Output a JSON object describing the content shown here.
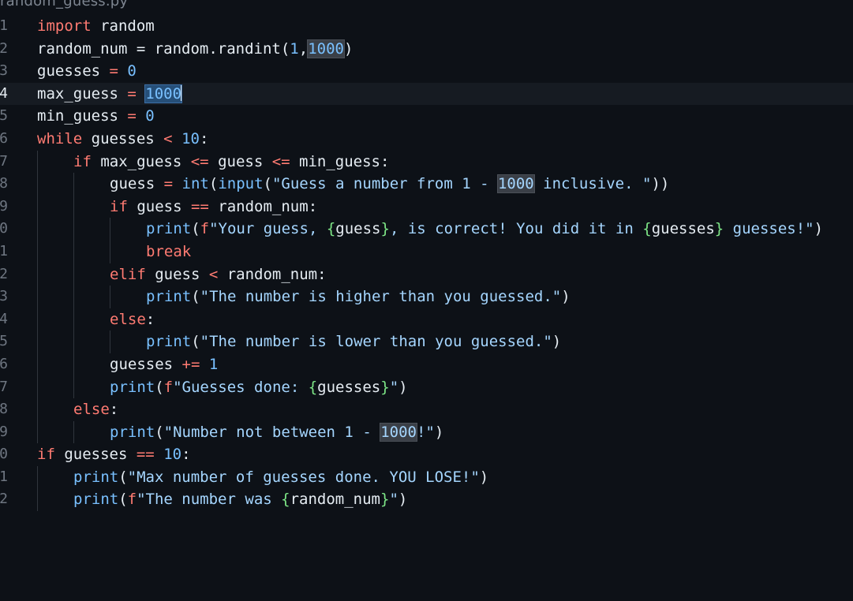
{
  "file": {
    "name": "random_guess.py"
  },
  "line_numbers": [
    "1",
    "2",
    "3",
    "4",
    "5",
    "6",
    "7",
    "8",
    "9",
    "0",
    "1",
    "2",
    "3",
    "4",
    "5",
    "6",
    "7",
    "8",
    "9",
    "0",
    "1",
    "2"
  ],
  "code": {
    "l1": {
      "kw": "import",
      "rest": " random"
    },
    "l2": {
      "a": "random_num = random.randint(",
      "n1": "1",
      "c": ",",
      "n2": "1000",
      "e": ")"
    },
    "l3": {
      "a": "guesses ",
      "op": "=",
      "sp": " ",
      "n": "0"
    },
    "l4": {
      "a": "max_guess ",
      "op": "=",
      "sp": " ",
      "n": "1000"
    },
    "l5": {
      "a": "min_guess ",
      "op": "=",
      "sp": " ",
      "n": "0"
    },
    "l6": {
      "kw": "while",
      "a": " guesses ",
      "op": "<",
      "sp": " ",
      "n": "10",
      "e": ":"
    },
    "l7": {
      "kw": "if",
      "a": " max_guess ",
      "op1": "<=",
      "b": " guess ",
      "op2": "<=",
      "c": " min_guess:"
    },
    "l8": {
      "a": "guess ",
      "op": "=",
      "sp": " ",
      "f1": "int",
      "p1": "(",
      "f2": "input",
      "p2": "(",
      "s1": "\"Guess a number from 1 - ",
      "hl": "1000",
      "s2": " inclusive. \"",
      "e": "))"
    },
    "l9": {
      "kw": "if",
      "a": " guess ",
      "op": "==",
      "b": " random_num:"
    },
    "l10": {
      "f": "print",
      "p": "(",
      "fp": "f",
      "s1": "\"Your guess, ",
      "b1": "{",
      "v1": "guess",
      "b2": "}",
      "s2": ", is correct! You did it in ",
      "b3": "{",
      "v2": "guesses",
      "b4": "}",
      "s3": " guesses!\"",
      "e": ")"
    },
    "l11": {
      "kw": "break"
    },
    "l12": {
      "kw": "elif",
      "a": " guess ",
      "op": "<",
      "b": " random_num:"
    },
    "l13": {
      "f": "print",
      "p": "(",
      "s": "\"The number is higher than you guessed.\"",
      "e": ")"
    },
    "l14": {
      "kw": "else",
      "e": ":"
    },
    "l15": {
      "f": "print",
      "p": "(",
      "s": "\"The number is lower than you guessed.\"",
      "e": ")"
    },
    "l16": {
      "a": "guesses ",
      "op": "+=",
      "sp": " ",
      "n": "1"
    },
    "l17": {
      "f": "print",
      "p": "(",
      "fp": "f",
      "s1": "\"Guesses done: ",
      "b1": "{",
      "v": "guesses",
      "b2": "}",
      "s2": "\"",
      "e": ")"
    },
    "l18": {
      "kw": "else",
      "e": ":"
    },
    "l19": {
      "f": "print",
      "p": "(",
      "s1": "\"Number not between 1 - ",
      "hl": "1000",
      "s2": "!\"",
      "e": ")"
    },
    "l20": {
      "kw": "if",
      "a": " guesses ",
      "op": "==",
      "sp": " ",
      "n": "10",
      "e": ":"
    },
    "l21": {
      "f": "print",
      "p": "(",
      "s": "\"Max number of guesses done. YOU LOSE!\"",
      "e": ")"
    },
    "l22": {
      "f": "print",
      "p": "(",
      "fp": "f",
      "s1": "\"The number was ",
      "b1": "{",
      "v": "random_num",
      "b2": "}",
      "s2": "\"",
      "e": ")"
    }
  },
  "colors": {
    "background": "#0d1117",
    "keyword": "#ff7b72",
    "number": "#79c0ff",
    "string": "#a5d6ff",
    "function": "#d2a8ff",
    "interpolation_brace": "#7ee787"
  }
}
